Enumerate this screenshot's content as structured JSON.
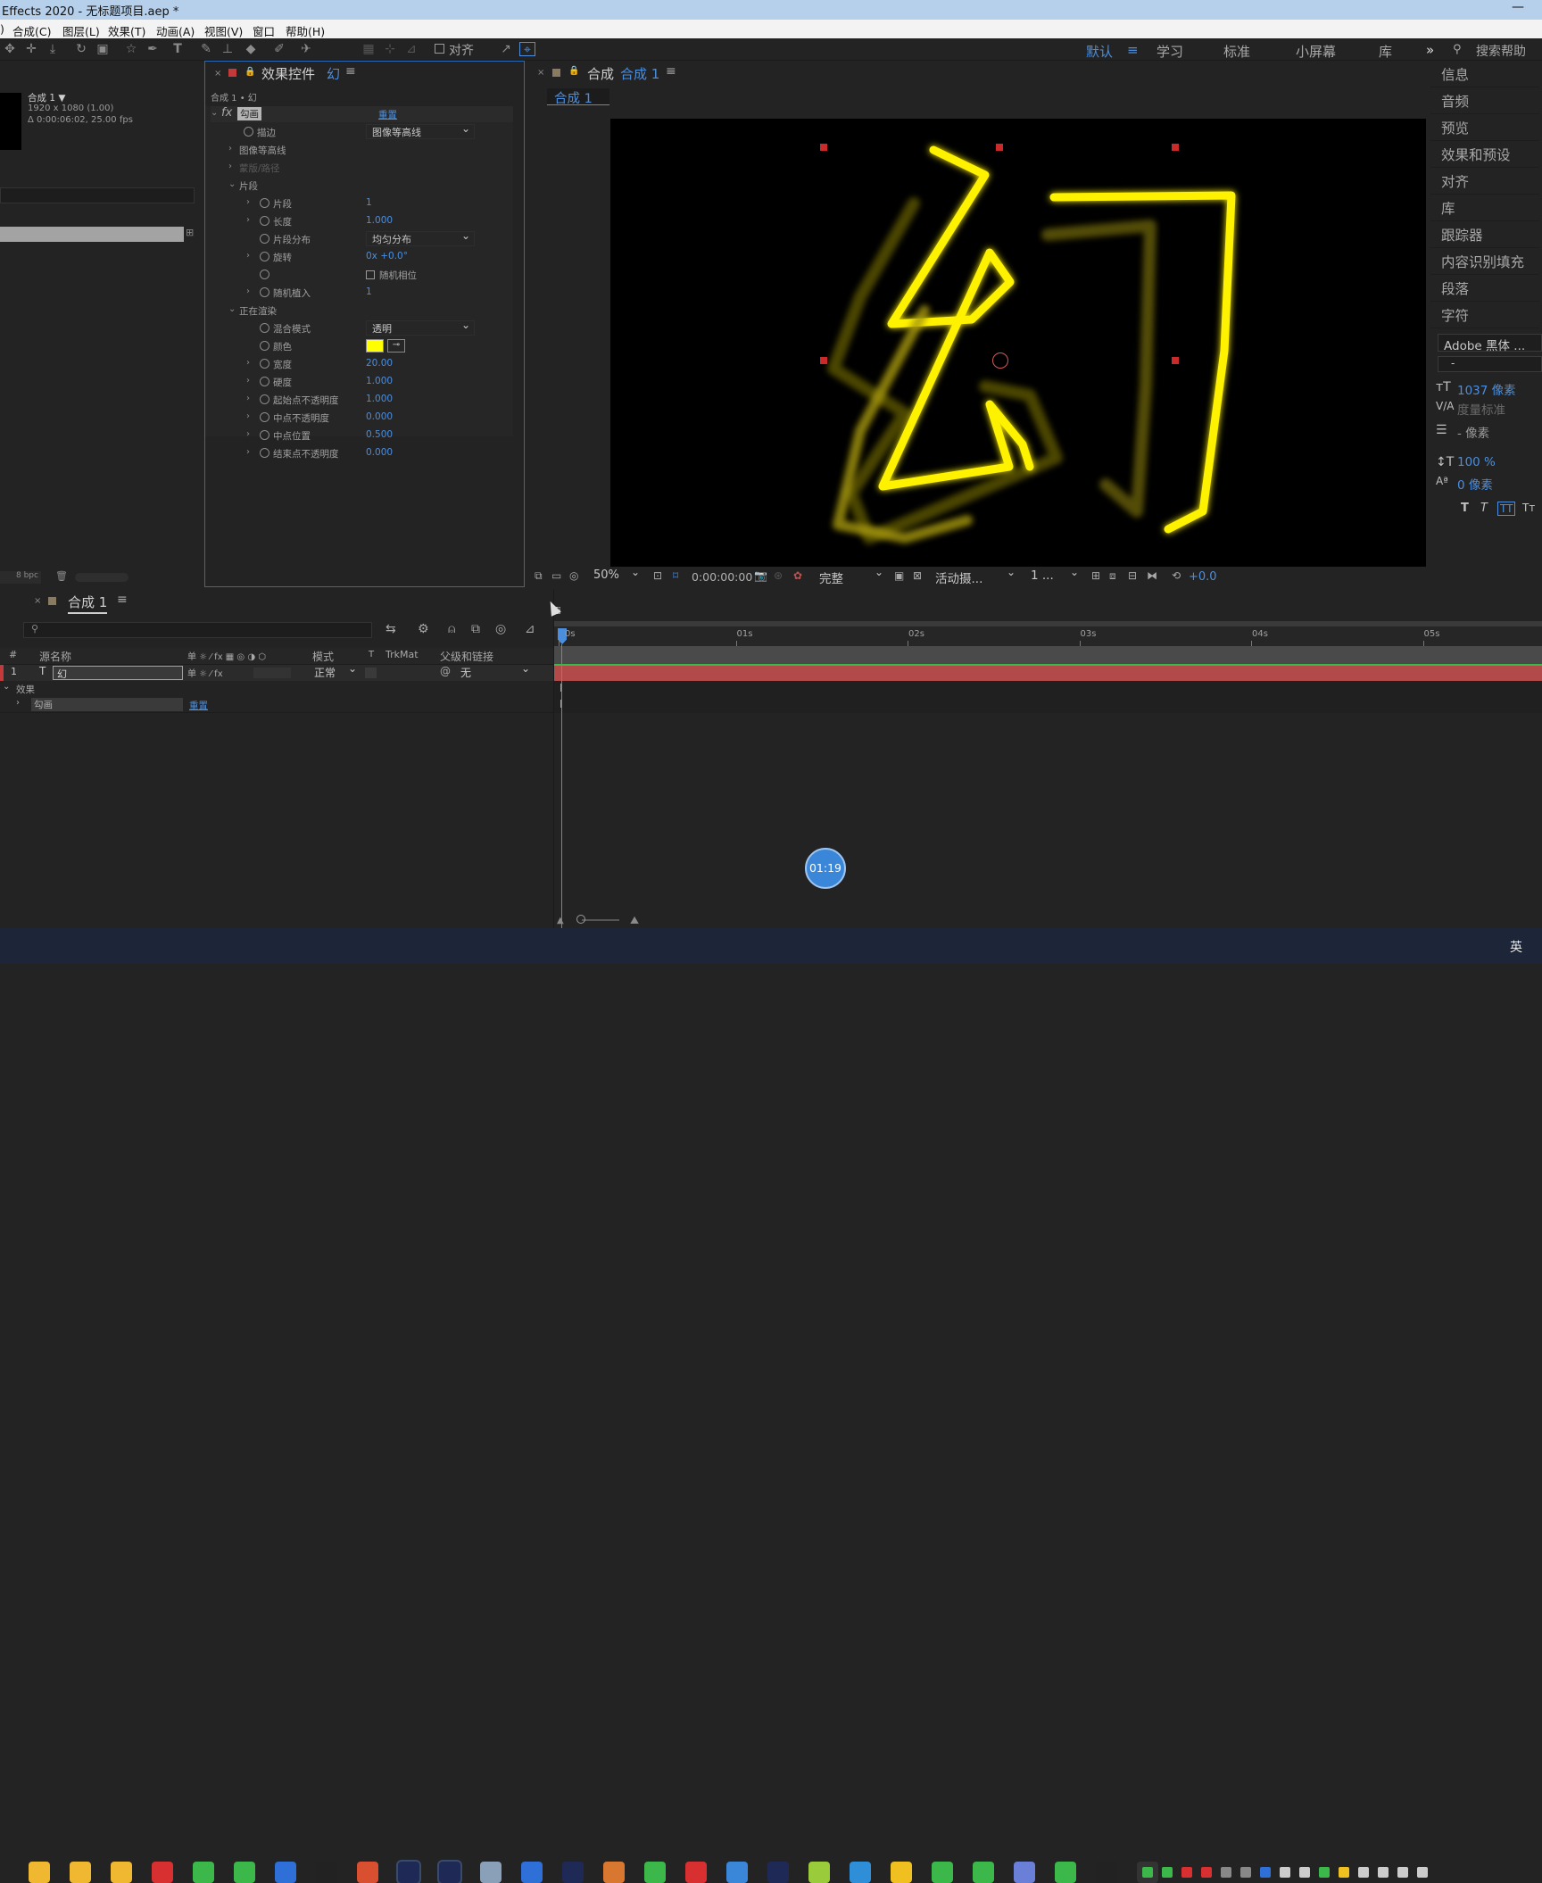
{
  "window": {
    "title": "Effects 2020 - 无标题项目.aep *",
    "close": "—"
  },
  "menu": [
    "合成(C)",
    "图层(L)",
    "效果(T)",
    "动画(A)",
    "视图(V)",
    "窗口",
    "帮助(H)"
  ],
  "toolbar": {
    "align_label": "对齐",
    "align_checked": false
  },
  "workspaces": {
    "items": [
      "默认",
      "学习",
      "标准",
      "小屏幕",
      "库"
    ],
    "active": "默认",
    "more": "»",
    "search_placeholder": "搜索帮助"
  },
  "project": {
    "comp_name": "合成 1 ▼",
    "comp_size": "1920 x 1080 (1.00)",
    "comp_duration": "Δ 0:00:06:02, 25.00 fps",
    "bpc": "8 bpc"
  },
  "effect_controls": {
    "tab_title": "效果控件",
    "tab_layer": "幻",
    "breadcrumb": "合成 1 • 幻",
    "effect_name": "勾画",
    "reset": "重置",
    "props": [
      {
        "label": "描边",
        "value": "图像等高线",
        "kind": "dropdown"
      },
      {
        "label": "图像等高线",
        "kind": "group"
      },
      {
        "label": "蒙版/路径",
        "kind": "group-disabled"
      },
      {
        "label": "片段",
        "kind": "group-open"
      },
      {
        "label": "片段",
        "value": "1",
        "kind": "num"
      },
      {
        "label": "长度",
        "value": "1.000",
        "kind": "num"
      },
      {
        "label": "片段分布",
        "value": "均匀分布",
        "kind": "dropdown"
      },
      {
        "label": "旋转",
        "value": "0x +0.0°",
        "kind": "num"
      },
      {
        "label": "",
        "value": "随机相位",
        "kind": "checkbox"
      },
      {
        "label": "随机植入",
        "value": "1",
        "kind": "num"
      },
      {
        "label": "正在渲染",
        "kind": "group-open"
      },
      {
        "label": "混合模式",
        "value": "透明",
        "kind": "dropdown"
      },
      {
        "label": "颜色",
        "value": "#ffff00",
        "kind": "color"
      },
      {
        "label": "宽度",
        "value": "20.00",
        "kind": "num"
      },
      {
        "label": "硬度",
        "value": "1.000",
        "kind": "num"
      },
      {
        "label": "起始点不透明度",
        "value": "1.000",
        "kind": "num"
      },
      {
        "label": "中点不透明度",
        "value": "0.000",
        "kind": "num"
      },
      {
        "label": "中点位置",
        "value": "0.500",
        "kind": "num"
      },
      {
        "label": "结束点不透明度",
        "value": "0.000",
        "kind": "num"
      }
    ]
  },
  "composition": {
    "tab_title": "合成",
    "tab_comp": "合成 1",
    "sub_tab": "合成 1",
    "canvas_char": "幻",
    "footer": {
      "zoom": "50%",
      "timecode": "0:00:00:00",
      "quality": "完整",
      "camera": "活动摄...",
      "views": "1 ...",
      "exposure": "+0.0"
    }
  },
  "right_panels": [
    "信息",
    "音频",
    "预览",
    "效果和预设",
    "对齐",
    "库",
    "跟踪器",
    "内容识别填充",
    "段落",
    "字符"
  ],
  "character": {
    "font": "Adobe 黑体 ...",
    "style": "-",
    "size": "1037 像素",
    "tracking_label": "度量标准",
    "leading": "- 像素",
    "vscale": "100 %",
    "baseline": "0 像素",
    "style_buttons": [
      "T",
      "T",
      "TT",
      "Tт"
    ]
  },
  "timeline": {
    "tab": "合成 1",
    "search_placeholder": "",
    "columns": {
      "num": "#",
      "source": "源名称",
      "mode": "模式",
      "t": "T",
      "trkmat": "TrkMat",
      "parent": "父级和链接"
    },
    "layer": {
      "index": "1",
      "type": "T",
      "name": "幻",
      "mode": "正常",
      "parent": "无"
    },
    "effects_label": "效果",
    "effect_name": "勾画",
    "effect_reset": "重置",
    "ruler": [
      "0s",
      "01s",
      "02s",
      "03s",
      "04s",
      "05s"
    ],
    "timer_badge": "01:19"
  },
  "taskbar": {
    "lang": "英"
  }
}
